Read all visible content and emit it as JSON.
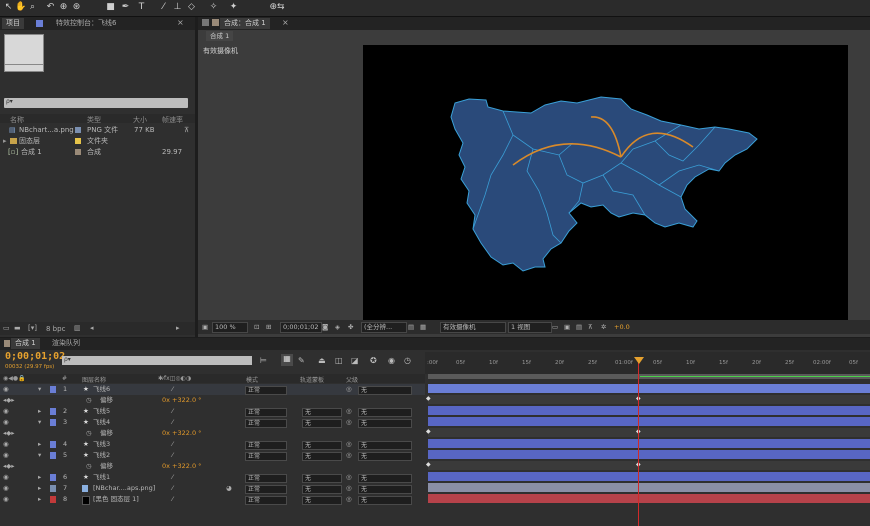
{
  "toolbar": {
    "tools": [
      "selection-tool-icon",
      "hand-tool-icon",
      "zoom-tool-icon",
      "rotate-tool-icon",
      "camera-orbit-icon",
      "pan-behind-icon",
      "rectangle-tool-icon",
      "pen-tool-icon",
      "type-tool-icon",
      "brush-tool-icon",
      "clone-stamp-icon",
      "eraser-icon",
      "roto-brush-icon",
      "puppet-tool-icon",
      "axis-icon"
    ]
  },
  "project": {
    "tab_project": "项目",
    "tab_effects": "特效控制台：飞线6",
    "search_placeholder": "ρ▾",
    "columns": {
      "name": "名称",
      "type": "类型",
      "size": "大小",
      "rate": "帧速率"
    },
    "items": [
      {
        "name": "NBchart...a.png",
        "type": "PNG 文件",
        "size": "77 KB",
        "rate": "",
        "color": "#7a8fb0"
      },
      {
        "name": "固态层",
        "type": "文件夹",
        "size": "",
        "rate": "",
        "color": "#e6c44a"
      },
      {
        "name": "合成 1",
        "type": "合成",
        "size": "",
        "rate": "29.97",
        "color": "#9a8a78"
      }
    ],
    "bpc": "8 bpc"
  },
  "viewer": {
    "tab": "合成：合成 1",
    "comp_button": "合成 1",
    "camera_label": "有效摄像机",
    "zoom": "100 %",
    "timecode": "0;00;01;02",
    "resolution": "(全分辨...",
    "camera_select": "有效摄像机",
    "view_select": "1 视图",
    "exposure": "+0.0"
  },
  "timeline": {
    "tab_comp": "合成 1",
    "tab_render": "渲染队列",
    "timecode": "0;00;01;02",
    "timecode_sub": "00032 (29.97 fps)",
    "search_placeholder": "ρ▾",
    "columns": {
      "num": "#",
      "source": "图层名称",
      "mode": "模式",
      "trkmat": "轨道蒙板",
      "parent": "父级"
    },
    "ruler": [
      ":00f",
      "05f",
      "10f",
      "15f",
      "20f",
      "25f",
      "01:00f",
      "05f",
      "10f",
      "15f",
      "20f",
      "25f",
      "02:00f",
      "05f"
    ],
    "layers": [
      {
        "kind": "layer",
        "num": "1",
        "name": "飞线6",
        "mode": "正常",
        "trk": "",
        "parent": "无",
        "color": "#6a7ed6",
        "bar": "#6a7ed6"
      },
      {
        "kind": "sub",
        "name": "偏移",
        "value": "0x +322.0 °",
        "bar": "#3a3a3a"
      },
      {
        "kind": "layer",
        "num": "2",
        "name": "飞线5",
        "mode": "正常",
        "trk": "无",
        "parent": "无",
        "color": "#6a7ed6",
        "bar": "#5866c4"
      },
      {
        "kind": "layer",
        "num": "3",
        "name": "飞线4",
        "mode": "正常",
        "trk": "无",
        "parent": "无",
        "color": "#6a7ed6",
        "bar": "#5866c4"
      },
      {
        "kind": "sub",
        "name": "偏移",
        "value": "0x +322.0 °",
        "bar": "#3a3a3a"
      },
      {
        "kind": "layer",
        "num": "4",
        "name": "飞线3",
        "mode": "正常",
        "trk": "无",
        "parent": "无",
        "color": "#6a7ed6",
        "bar": "#5866c4"
      },
      {
        "kind": "layer",
        "num": "5",
        "name": "飞线2",
        "mode": "正常",
        "trk": "无",
        "parent": "无",
        "color": "#6a7ed6",
        "bar": "#5866c4"
      },
      {
        "kind": "sub",
        "name": "偏移",
        "value": "0x +322.0 °",
        "bar": "#3a3a3a"
      },
      {
        "kind": "layer",
        "num": "6",
        "name": "飞线1",
        "mode": "正常",
        "trk": "无",
        "parent": "无",
        "color": "#6a7ed6",
        "bar": "#5866c4"
      },
      {
        "kind": "layer",
        "num": "7",
        "name": "[NBchar....aps.png]",
        "mode": "正常",
        "trk": "无",
        "parent": "无",
        "color": "#7a8fb0",
        "bar": "#8a8fa6"
      },
      {
        "kind": "layer",
        "num": "8",
        "name": "[黑色 固态层 1]",
        "mode": "正常",
        "trk": "无",
        "parent": "无",
        "color": "#c23a3a",
        "bar": "#b6424a"
      }
    ]
  },
  "colors": {
    "accent": "#e6a12e",
    "map_fill": "#2a4a7a",
    "map_stroke": "#3aa0d8",
    "arc": "#d98a2a"
  }
}
